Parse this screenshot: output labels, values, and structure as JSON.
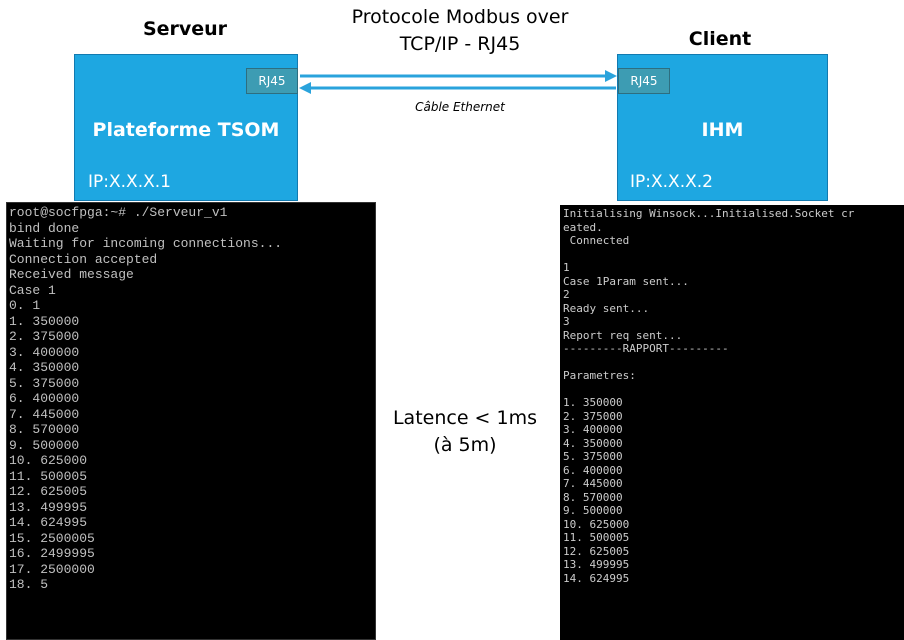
{
  "server": {
    "heading": "Serveur",
    "box_title": "Plateforme TSOM",
    "ip": "IP:X.X.X.1",
    "port": "RJ45"
  },
  "client": {
    "heading": "Client",
    "box_title": "IHM",
    "ip": "IP:X.X.X.2",
    "port": "RJ45"
  },
  "protocol": {
    "line1": "Protocole Modbus over",
    "line2": "TCP/IP - RJ45"
  },
  "cable_label": "Câble Ethernet",
  "latency": {
    "line1": "Latence < 1ms",
    "line2": "(à 5m)"
  },
  "colors": {
    "box": "#1ea7e1",
    "port": "#3d9cb3",
    "arrow": "#2aa3dc"
  },
  "server_terminal": [
    "root@socfpga:~# ./Serveur_v1",
    "bind done",
    "Waiting for incoming connections...",
    "Connection accepted",
    "Received message",
    "Case 1",
    "0. 1",
    "1. 350000",
    "2. 375000",
    "3. 400000",
    "4. 350000",
    "5. 375000",
    "6. 400000",
    "7. 445000",
    "8. 570000",
    "9. 500000",
    "10. 625000",
    "11. 500005",
    "12. 625005",
    "13. 499995",
    "14. 624995",
    "15. 2500005",
    "16. 2499995",
    "17. 2500000",
    "18. 5"
  ],
  "client_terminal": [
    "Initialising Winsock...Initialised.Socket cr",
    "eated.",
    " Connected",
    "",
    "1",
    "Case 1Param sent...",
    "2",
    "Ready sent...",
    "3",
    "Report req sent...",
    "---------RAPPORT---------",
    "",
    "Parametres:",
    "",
    "1. 350000",
    "2. 375000",
    "3. 400000",
    "4. 350000",
    "5. 375000",
    "6. 400000",
    "7. 445000",
    "8. 570000",
    "9. 500000",
    "10. 625000",
    "11. 500005",
    "12. 625005",
    "13. 499995",
    "14. 624995"
  ]
}
